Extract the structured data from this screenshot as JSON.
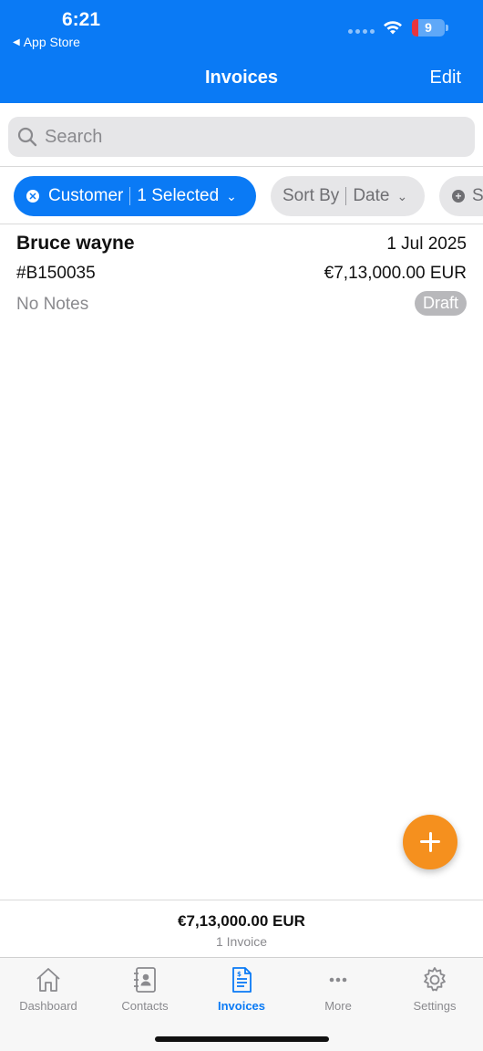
{
  "status_bar": {
    "time": "6:21",
    "back_app": "App Store",
    "battery": "9"
  },
  "nav": {
    "title": "Invoices",
    "edit_label": "Edit"
  },
  "search": {
    "placeholder": "Search"
  },
  "filters": {
    "customer_label": "Customer",
    "customer_value": "1 Selected",
    "sort_label": "Sort By",
    "sort_value": "Date",
    "more_label": "S"
  },
  "invoices": [
    {
      "customer": "Bruce wayne",
      "date": "1 Jul 2025",
      "number": "#B150035",
      "amount": "€7,13,000.00 EUR",
      "notes": "No Notes",
      "status": "Draft"
    }
  ],
  "summary": {
    "total": "€7,13,000.00 EUR",
    "count": "1 Invoice"
  },
  "tabs": [
    {
      "label": "Dashboard",
      "icon": "home-icon",
      "active": false
    },
    {
      "label": "Contacts",
      "icon": "contacts-book-icon",
      "active": false
    },
    {
      "label": "Invoices",
      "icon": "invoice-document-icon",
      "active": true
    },
    {
      "label": "More",
      "icon": "more-dots-icon",
      "active": false
    },
    {
      "label": "Settings",
      "icon": "gear-icon",
      "active": false
    }
  ],
  "colors": {
    "primary": "#0a7af5",
    "fab": "#f5901e",
    "draft_badge": "#b8b8bb"
  }
}
